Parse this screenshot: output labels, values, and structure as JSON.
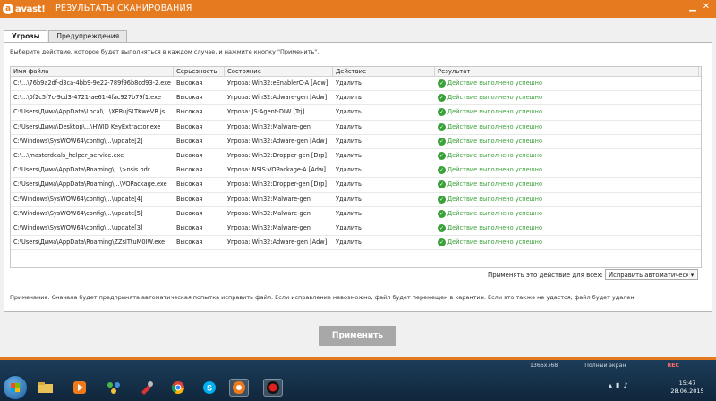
{
  "app": {
    "logo_text": "avast!",
    "title": "РЕЗУЛЬТАТЫ СКАНИРОВАНИЯ",
    "brand_color": "#e67a1e",
    "controls": {
      "minimize": "▁",
      "close": "✕"
    }
  },
  "tabs": [
    {
      "label": "Угрозы",
      "active": true
    },
    {
      "label": "Предупреждения",
      "active": false
    }
  ],
  "instruction": "Выберите действие, которое будет выполняться в каждом случае, и нажмите кнопку \"Применить\".",
  "table": {
    "columns": [
      "Имя файла",
      "Серьезность",
      "Состояние",
      "Действие",
      "Результат"
    ],
    "rows": [
      {
        "file": "C:\\...\\76b9a2df-d3ca-4bb9-9e22-789f96b8cd93-2.exe",
        "severity": "Высокая",
        "status": "Угроза: Win32:eEnablerC-A [Adw]",
        "action": "Удалить",
        "result": "Действие выполнено успешно"
      },
      {
        "file": "C:\\...\\0f2c5f7c-9cd3-4721-ae61-4fac927b79f1.exe",
        "severity": "Высокая",
        "status": "Угроза: Win32:Adware-gen [Adw]",
        "action": "Удалить",
        "result": "Действие выполнено успешно"
      },
      {
        "file": "C:\\Users\\Дима\\AppData\\Local\\...\\XERujSLTKweVB.js",
        "severity": "Высокая",
        "status": "Угроза: JS:Agent-DIW [Trj]",
        "action": "Удалить",
        "result": "Действие выполнено успешно"
      },
      {
        "file": "C:\\Users\\Дима\\Desktop\\...\\HWID KeyExtractor.exe",
        "severity": "Высокая",
        "status": "Угроза: Win32:Malware-gen",
        "action": "Удалить",
        "result": "Действие выполнено успешно"
      },
      {
        "file": "C:\\Windows\\SysWOW64\\config\\...\\update[2]",
        "severity": "Высокая",
        "status": "Угроза: Win32:Adware-gen [Adw]",
        "action": "Удалить",
        "result": "Действие выполнено успешно"
      },
      {
        "file": "C:\\...\\masterdeals_helper_service.exe",
        "severity": "Высокая",
        "status": "Угроза: Win32:Dropper-gen [Drp]",
        "action": "Удалить",
        "result": "Действие выполнено успешно"
      },
      {
        "file": "C:\\Users\\Дима\\AppData\\Roaming\\...\\>nsis.hdr",
        "severity": "Высокая",
        "status": "Угроза: NSIS:VOPackage-A [Adw]",
        "action": "Удалить",
        "result": "Действие выполнено успешно"
      },
      {
        "file": "C:\\Users\\Дима\\AppData\\Roaming\\...\\VOPackage.exe",
        "severity": "Высокая",
        "status": "Угроза: Win32:Dropper-gen [Drp]",
        "action": "Удалить",
        "result": "Действие выполнено успешно"
      },
      {
        "file": "C:\\Windows\\SysWOW64\\config\\...\\update[4]",
        "severity": "Высокая",
        "status": "Угроза: Win32:Malware-gen",
        "action": "Удалить",
        "result": "Действие выполнено успешно"
      },
      {
        "file": "C:\\Windows\\SysWOW64\\config\\...\\update[5]",
        "severity": "Высокая",
        "status": "Угроза: Win32:Malware-gen",
        "action": "Удалить",
        "result": "Действие выполнено успешно"
      },
      {
        "file": "C:\\Windows\\SysWOW64\\config\\...\\update[3]",
        "severity": "Высокая",
        "status": "Угроза: Win32:Malware-gen",
        "action": "Удалить",
        "result": "Действие выполнено успешно"
      },
      {
        "file": "C:\\Users\\Дима\\AppData\\Roaming\\ZZsITtuM0IW.exe",
        "severity": "Высокая",
        "status": "Угроза: Win32:Adware-gen [Adw]",
        "action": "Удалить",
        "result": "Действие выполнено успешно"
      }
    ],
    "result_color": "#3aa13a"
  },
  "apply_all": {
    "label": "Применять это действие для всех:",
    "selected": "Исправить автоматически"
  },
  "note": "Примечание. Сначала будет предпринята автоматическая попытка исправить файл. Если исправление невозможно, файл будет перемещен в карантин. Если это также не удастся, файл будет удален.",
  "apply_button": "Применить",
  "recorder": {
    "resolution": "1366x768",
    "mode": "Полный экран",
    "rec": "REC"
  },
  "taskbar": {
    "icons": [
      "explorer-icon",
      "media-player-icon",
      "network-app-icon",
      "tools-icon",
      "chrome-icon",
      "skype-icon",
      "avast-icon",
      "recorder-icon"
    ],
    "clock_time": "15:47",
    "clock_date": "28.06.2015"
  }
}
